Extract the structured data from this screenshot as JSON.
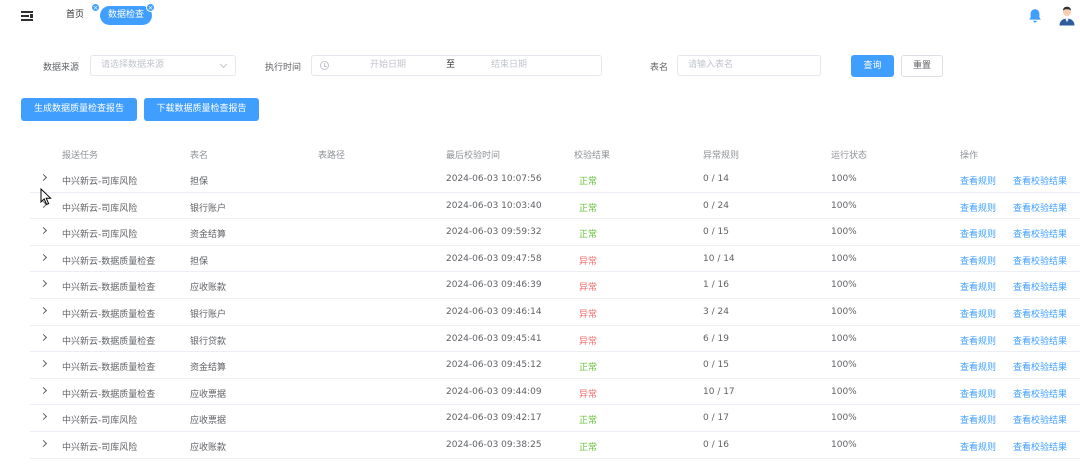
{
  "header": {
    "tabs": [
      {
        "label": "首页"
      },
      {
        "label": "数据检查"
      }
    ],
    "tab_close_glyph": "×",
    "icons": {
      "menu": "menu-fold-icon",
      "bell": "bell-icon",
      "avatar": "avatar"
    }
  },
  "filters": {
    "source_label": "数据来源",
    "source_placeholder": "请选择数据来源",
    "exec_time_label": "执行时间",
    "start_placeholder": "开始日期",
    "range_separator": "至",
    "end_placeholder": "结束日期",
    "table_label": "表名",
    "table_placeholder": "请输入表名",
    "query_label": "查询",
    "reset_label": "重置"
  },
  "actions": {
    "generate_label": "生成数据质量检查报告",
    "download_label": "下载数据质量检查报告"
  },
  "table": {
    "columns": [
      "报送任务",
      "表名",
      "表路径",
      "最后校验时间",
      "校验结果",
      "异常规则",
      "运行状态",
      "操作"
    ],
    "rows": [
      {
        "task": "中兴新云-司库风险",
        "table": "担保",
        "path": "",
        "time": "2024-06-03 10:07:56",
        "result": "正常",
        "ok": true,
        "rules": "0 / 14",
        "status": "100%"
      },
      {
        "task": "中兴新云-司库风险",
        "table": "银行账户",
        "path": "",
        "time": "2024-06-03 10:03:40",
        "result": "正常",
        "ok": true,
        "rules": "0 / 24",
        "status": "100%"
      },
      {
        "task": "中兴新云-司库风险",
        "table": "资金结算",
        "path": "",
        "time": "2024-06-03 09:59:32",
        "result": "正常",
        "ok": true,
        "rules": "0 / 15",
        "status": "100%"
      },
      {
        "task": "中兴新云-数据质量检查",
        "table": "担保",
        "path": "",
        "time": "2024-06-03 09:47:58",
        "result": "异常",
        "ok": false,
        "rules": "10 / 14",
        "status": "100%"
      },
      {
        "task": "中兴新云-数据质量检查",
        "table": "应收账款",
        "path": "",
        "time": "2024-06-03 09:46:39",
        "result": "异常",
        "ok": false,
        "rules": "1 / 16",
        "status": "100%"
      },
      {
        "task": "中兴新云-数据质量检查",
        "table": "银行账户",
        "path": "",
        "time": "2024-06-03 09:46:14",
        "result": "异常",
        "ok": false,
        "rules": "3 / 24",
        "status": "100%"
      },
      {
        "task": "中兴新云-数据质量检查",
        "table": "银行贷款",
        "path": "",
        "time": "2024-06-03 09:45:41",
        "result": "异常",
        "ok": false,
        "rules": "6 / 19",
        "status": "100%"
      },
      {
        "task": "中兴新云-数据质量检查",
        "table": "资金结算",
        "path": "",
        "time": "2024-06-03 09:45:12",
        "result": "正常",
        "ok": true,
        "rules": "0 / 15",
        "status": "100%"
      },
      {
        "task": "中兴新云-数据质量检查",
        "table": "应收票据",
        "path": "",
        "time": "2024-06-03 09:44:09",
        "result": "异常",
        "ok": false,
        "rules": "10 / 17",
        "status": "100%"
      },
      {
        "task": "中兴新云-司库风险",
        "table": "应收票据",
        "path": "",
        "time": "2024-06-03 09:42:17",
        "result": "正常",
        "ok": true,
        "rules": "0 / 17",
        "status": "100%"
      },
      {
        "task": "中兴新云-司库风险",
        "table": "应收账款",
        "path": "",
        "time": "2024-06-03 09:38:25",
        "result": "正常",
        "ok": true,
        "rules": "0 / 16",
        "status": "100%"
      }
    ],
    "action_view_rules": "查看规则",
    "action_view_results": "查看校验结果"
  },
  "colors": {
    "primary": "#409eff",
    "success": "#67c23a",
    "danger": "#f56c6c"
  }
}
